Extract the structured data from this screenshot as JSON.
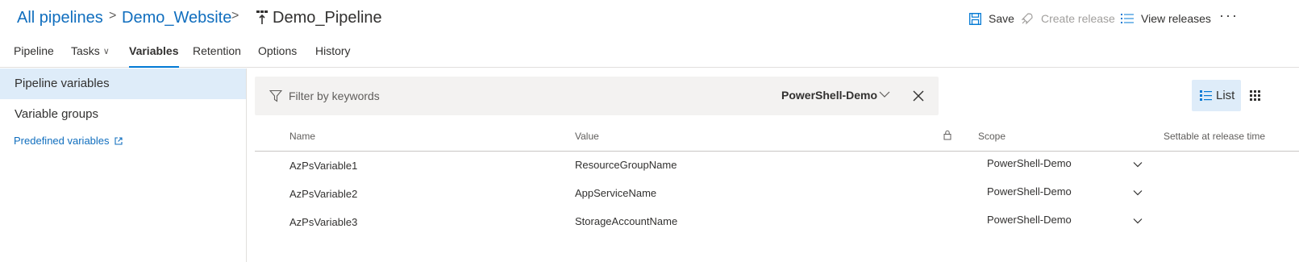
{
  "breadcrumb": {
    "all_pipelines": "All pipelines",
    "project": "Demo_Website",
    "pipeline": "Demo_Pipeline",
    "separator": ">"
  },
  "toolbar": {
    "save_label": "Save",
    "create_release_label": "Create release",
    "view_releases_label": "View releases",
    "more_label": "···"
  },
  "tabs": [
    "Pipeline",
    "Tasks",
    "Variables",
    "Retention",
    "Options",
    "History"
  ],
  "active_tab": "Variables",
  "sidebar": {
    "items": [
      "Pipeline variables",
      "Variable groups"
    ],
    "link": "Predefined variables"
  },
  "filter": {
    "placeholder": "Filter by keywords",
    "scope_value": "PowerShell-Demo"
  },
  "view": {
    "list_label": "List"
  },
  "table": {
    "columns": [
      "Name",
      "Value",
      "Scope",
      "Settable at release time"
    ],
    "rows": [
      {
        "name": "AzPsVariable1",
        "value": "ResourceGroupName",
        "scope": "PowerShell-Demo"
      },
      {
        "name": "AzPsVariable2",
        "value": "AppServiceName",
        "scope": "PowerShell-Demo"
      },
      {
        "name": "AzPsVariable3",
        "value": "StorageAccountName",
        "scope": "PowerShell-Demo"
      }
    ]
  },
  "colors": {
    "accent": "#0078d4",
    "link": "#106ebe",
    "selected_bg": "#deecf9",
    "filter_bg": "#f3f2f1"
  },
  "icons": [
    "pipeline-icon",
    "save-icon",
    "rocket-icon",
    "list-icon",
    "more-icon",
    "chevron-down-icon",
    "external-link-icon",
    "filter-icon",
    "close-icon",
    "grid-icon",
    "lock-icon"
  ]
}
